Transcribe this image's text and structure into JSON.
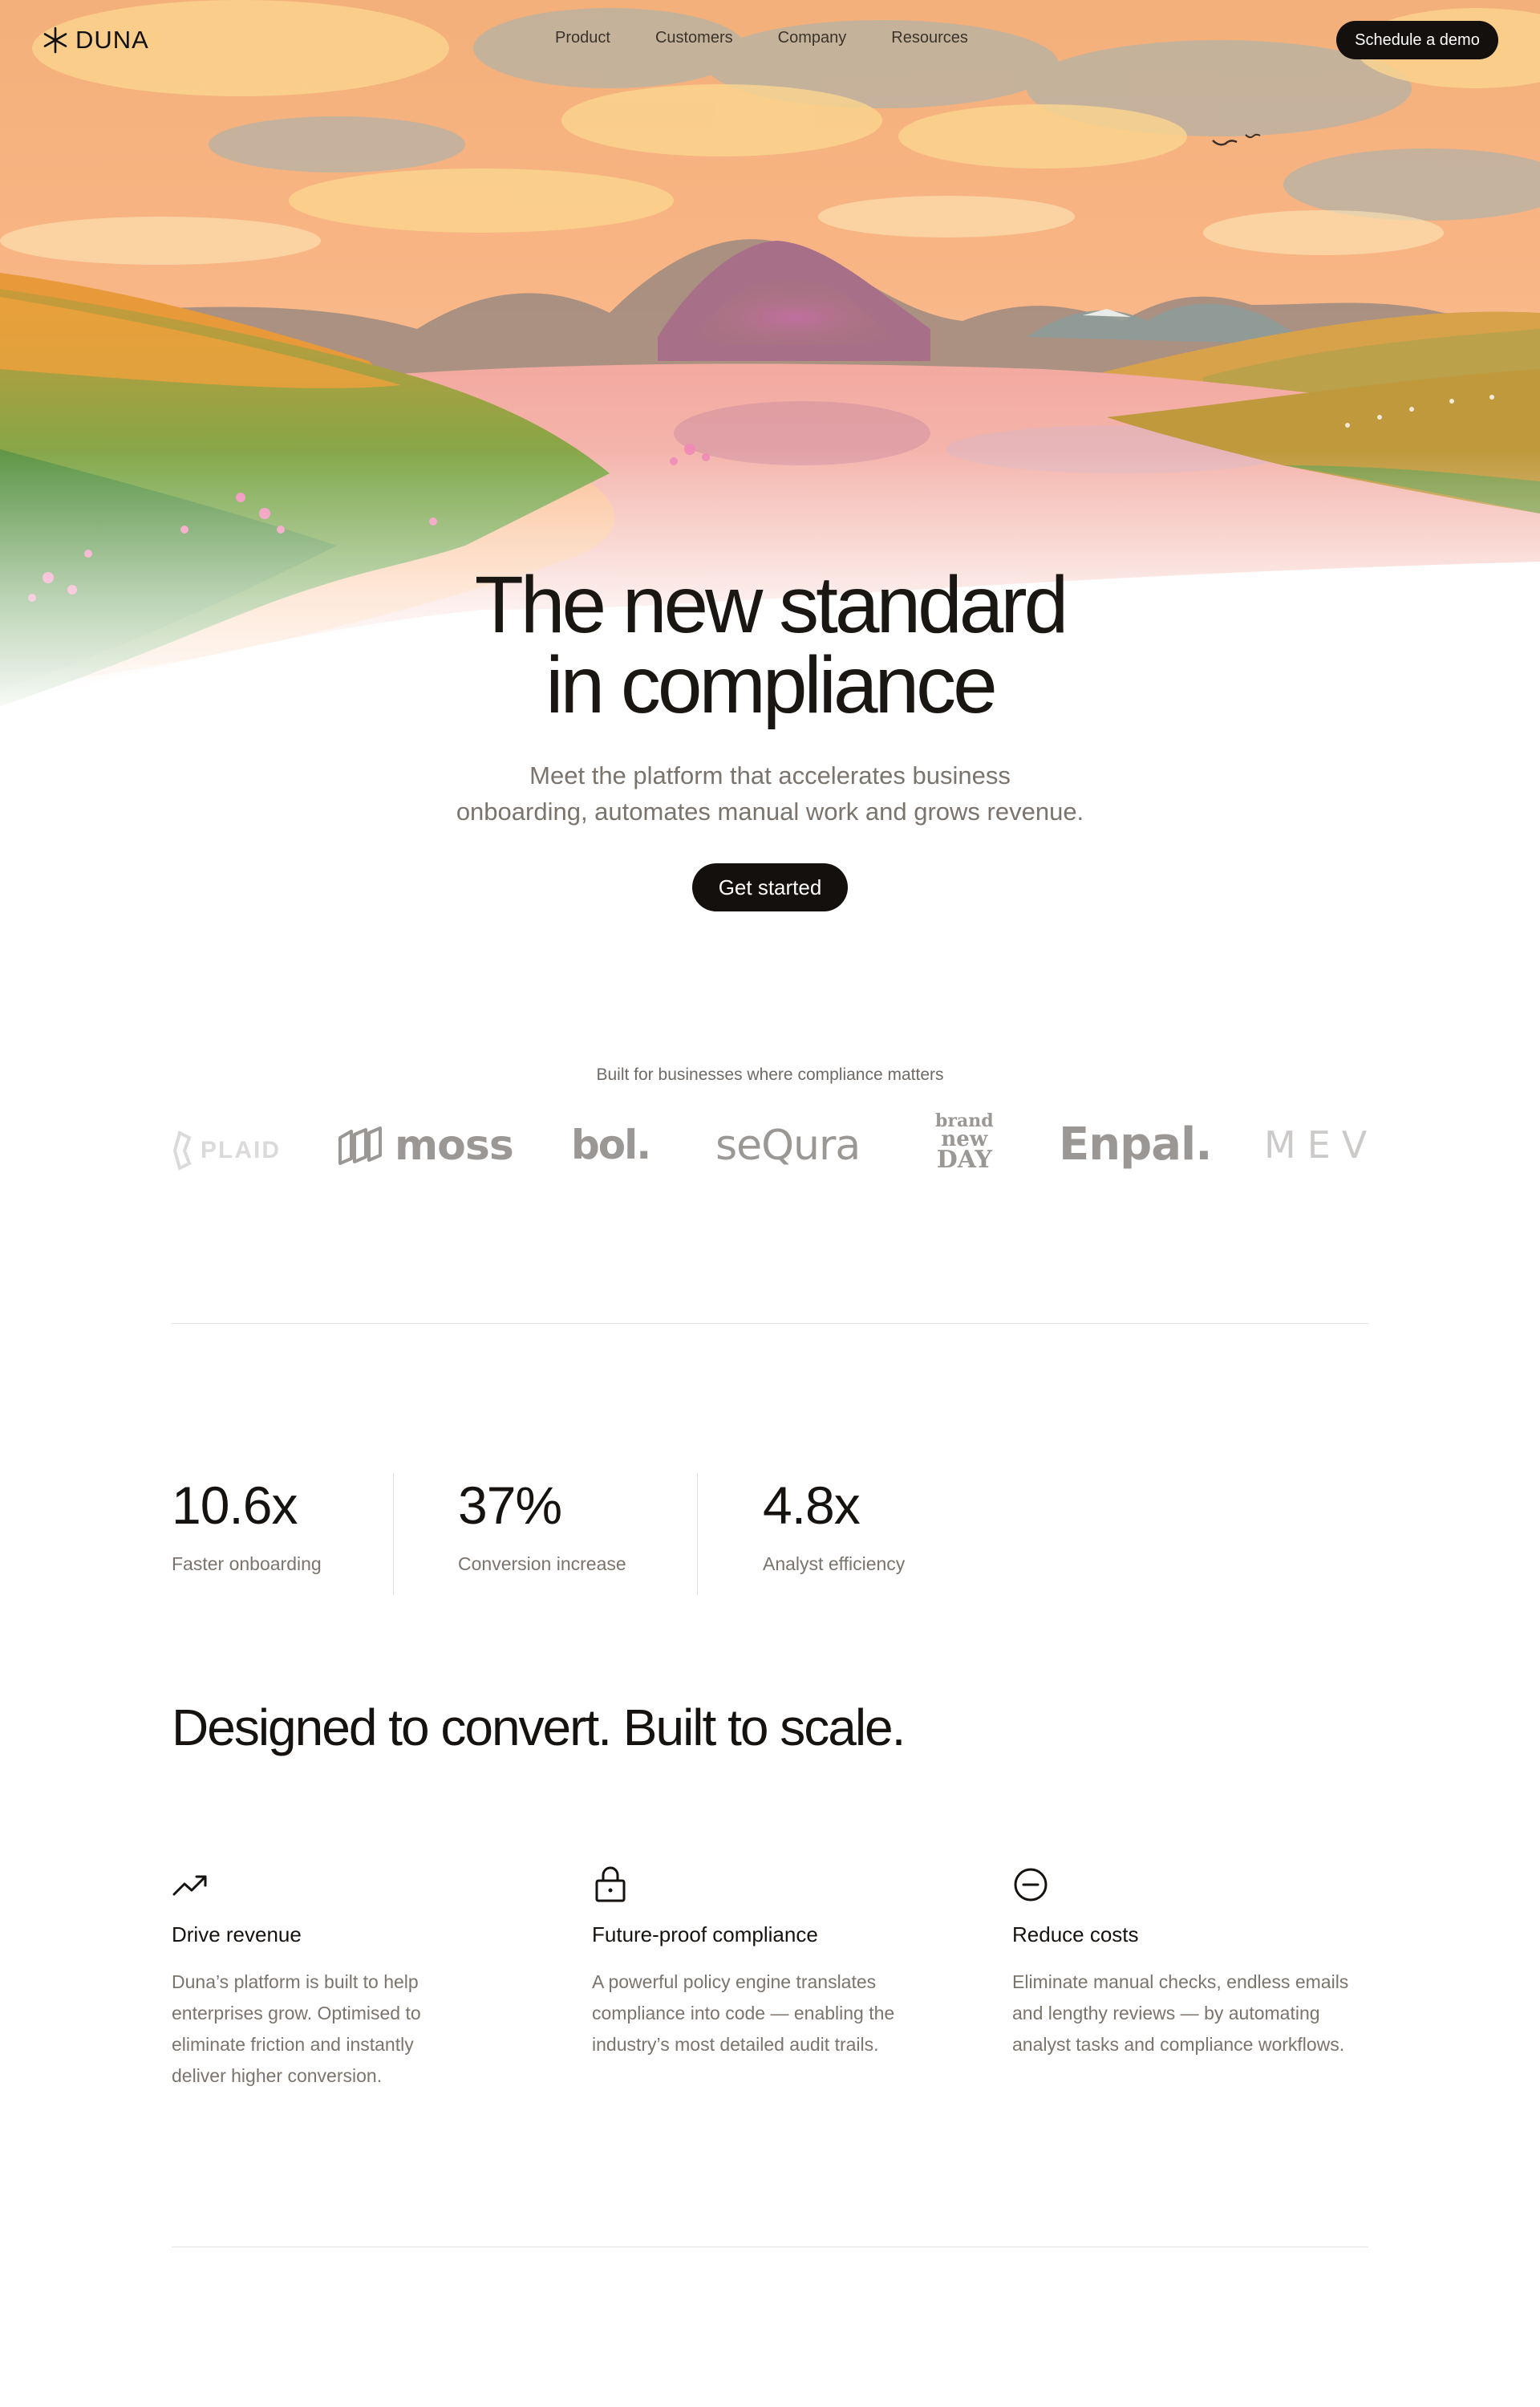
{
  "nav": {
    "logo": "DUNA",
    "links": [
      "Product",
      "Customers",
      "Company",
      "Resources"
    ],
    "cta": "Schedule a demo"
  },
  "hero": {
    "title_line1": "The new standard",
    "title_line2": "in compliance",
    "subtitle_line1": "Meet the platform that accelerates business",
    "subtitle_line2": "onboarding, automates manual work and grows revenue.",
    "cta": "Get started"
  },
  "logos": {
    "caption": "Built for businesses where compliance matters",
    "brands": {
      "plaid": "PLAID",
      "moss": "moss",
      "bol": "bol.",
      "sequra": "seQura",
      "bnd_1": "brand",
      "bnd_2": "new",
      "bnd_3": "DAY",
      "enpal": "Enpal.",
      "mev": "MEV"
    }
  },
  "stats": [
    {
      "value": "10.6x",
      "label": "Faster onboarding"
    },
    {
      "value": "37%",
      "label": "Conversion increase"
    },
    {
      "value": "4.8x",
      "label": "Analyst efficiency"
    }
  ],
  "features": {
    "heading": "Designed to convert. Built to scale.",
    "items": [
      {
        "icon": "trending-up-icon",
        "title": "Drive revenue",
        "text": "Duna’s platform is built to help enterprises grow. Optimised to eliminate friction and instantly deliver higher conversion."
      },
      {
        "icon": "lock-icon",
        "title": "Future-proof compliance",
        "text": "A powerful policy engine translates compliance into code — enabling the industry’s most detailed audit trails."
      },
      {
        "icon": "minus-circle-icon",
        "title": "Reduce costs",
        "text": "Eliminate manual checks, endless emails and lengthy reviews — by automating analyst tasks and compliance workflows."
      }
    ]
  },
  "colors": {
    "accent_dark": "#14100d",
    "muted_text": "#7b746d",
    "sky_orange": "#f7a877"
  }
}
